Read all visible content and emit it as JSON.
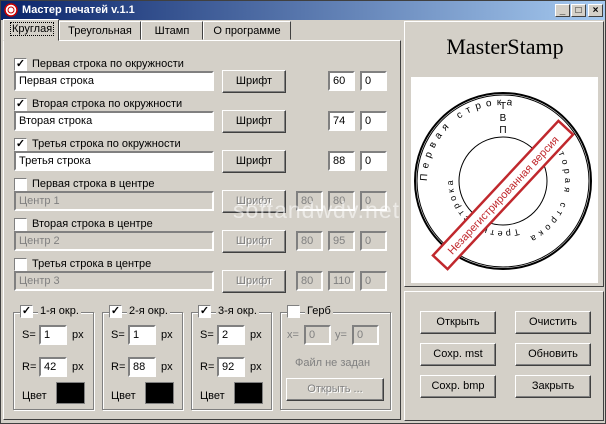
{
  "window": {
    "title": "Мастер печатей v.1.1"
  },
  "tabs": [
    "Круглая",
    "Треугольная",
    "Штамп",
    "О программе"
  ],
  "rows": [
    {
      "checked": true,
      "label": "Первая строка по окружности",
      "value": "Первая строка",
      "font": "Шрифт",
      "n1": "60",
      "n2": "0"
    },
    {
      "checked": true,
      "label": "Вторая строка по окружности",
      "value": "Вторая строка",
      "font": "Шрифт",
      "n1": "74",
      "n2": "0"
    },
    {
      "checked": true,
      "label": "Третья строка по окружности",
      "value": "Третья строка",
      "font": "Шрифт",
      "n1": "88",
      "n2": "0"
    },
    {
      "checked": false,
      "label": "Первая строка в центре",
      "value": "Центр 1",
      "font": "Шрифт",
      "n1": "80",
      "n2": "80",
      "n3": "0"
    },
    {
      "checked": false,
      "label": "Вторая строка в центре",
      "value": "Центр 2",
      "font": "Шрифт",
      "n1": "80",
      "n2": "95",
      "n3": "0"
    },
    {
      "checked": false,
      "label": "Третья строка в центре",
      "value": "Центр 3",
      "font": "Шрифт",
      "n1": "80",
      "n2": "110",
      "n3": "0"
    }
  ],
  "circles": [
    {
      "label": "1-я окр.",
      "s_label": "S=",
      "s": "1",
      "r_label": "R=",
      "r": "42",
      "unit": "px",
      "color_label": "Цвет",
      "color": "#000000"
    },
    {
      "label": "2-я окр.",
      "s_label": "S=",
      "s": "1",
      "r_label": "R=",
      "r": "88",
      "unit": "px",
      "color_label": "Цвет",
      "color": "#000000"
    },
    {
      "label": "3-я окр.",
      "s_label": "S=",
      "s": "2",
      "r_label": "R=",
      "r": "92",
      "unit": "px",
      "color_label": "Цвет",
      "color": "#000000"
    }
  ],
  "emblem": {
    "label": "Герб",
    "x_label": "x=",
    "x": "0",
    "y_label": "y=",
    "y": "0",
    "status": "Файл не задан",
    "open": "Открыть ..."
  },
  "preview": {
    "logo": "MasterStamp",
    "stamp_banner": "Незарегистрированная версия",
    "watermark": "softandwdv.net",
    "outer_letters": "Первая строка",
    "mid_letters": "Вторая строка",
    "inner_letters": "Третья строка",
    "tvp": [
      "Т",
      "В",
      "П"
    ]
  },
  "actions": {
    "open": "Открыть",
    "clear": "Очистить",
    "save_mst": "Сохр. mst",
    "refresh": "Обновить",
    "save_bmp": "Сохр. bmp",
    "close": "Закрыть"
  },
  "colors": {
    "titlebar_start": "#0a246a",
    "titlebar_end": "#a6caf0",
    "banner": "#c0282d"
  }
}
